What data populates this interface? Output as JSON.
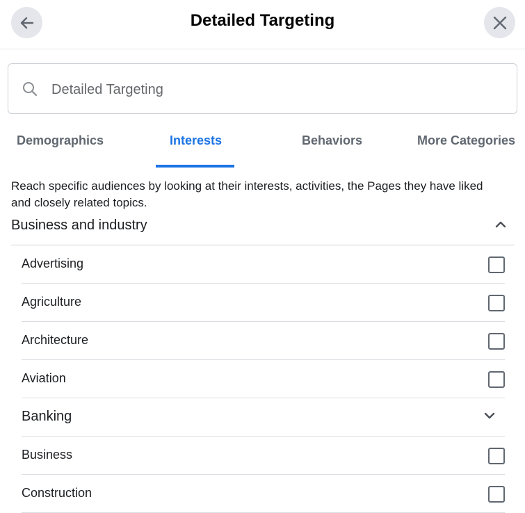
{
  "header": {
    "title": "Detailed Targeting",
    "back_icon": "arrow-left-icon",
    "close_icon": "close-icon"
  },
  "search": {
    "placeholder": "Detailed Targeting",
    "value": "",
    "icon": "search-icon"
  },
  "tabs": [
    {
      "label": "Demographics",
      "active": false
    },
    {
      "label": "Interests",
      "active": true
    },
    {
      "label": "Behaviors",
      "active": false
    },
    {
      "label": "More Categories",
      "active": false
    }
  ],
  "description": "Reach specific audiences by looking at their interests, activities, the Pages they have liked and closely related topics.",
  "category": {
    "label": "Business and industry",
    "expanded": true,
    "icon": "chevron-up-icon",
    "items": [
      {
        "label": "Advertising",
        "type": "checkbox",
        "checked": false
      },
      {
        "label": "Agriculture",
        "type": "checkbox",
        "checked": false
      },
      {
        "label": "Architecture",
        "type": "checkbox",
        "checked": false
      },
      {
        "label": "Aviation",
        "type": "checkbox",
        "checked": false
      },
      {
        "label": "Banking",
        "type": "subcategory",
        "expanded": false,
        "icon": "chevron-down-icon"
      },
      {
        "label": "Business",
        "type": "checkbox",
        "checked": false
      },
      {
        "label": "Construction",
        "type": "checkbox",
        "checked": false
      }
    ]
  },
  "colors": {
    "accent": "#1b74e4",
    "tab_inactive": "#606770",
    "icon_button_bg": "#e4e6eb",
    "divider": "#dadde1"
  }
}
